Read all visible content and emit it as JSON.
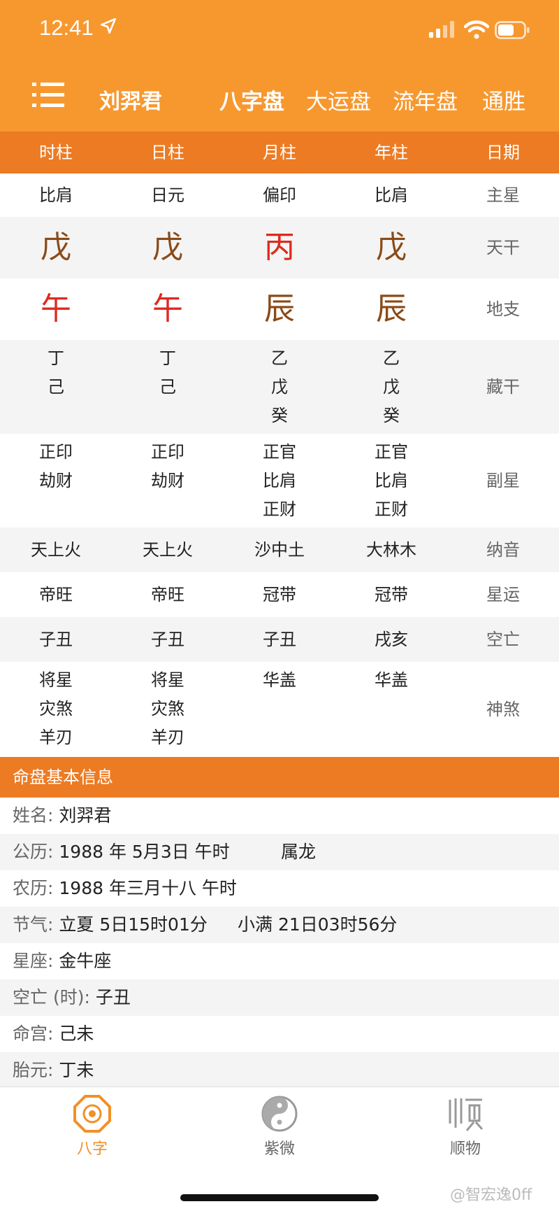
{
  "status": {
    "time": "12:41"
  },
  "header": {
    "name": "刘羿君",
    "tabs": [
      "八字盘",
      "大运盘",
      "流年盘",
      "通胜"
    ]
  },
  "columns": [
    "时柱",
    "日柱",
    "月柱",
    "年柱",
    "日期"
  ],
  "rows": {
    "main_star": {
      "label": "主星",
      "values": [
        "比肩",
        "日元",
        "偏印",
        "比肩"
      ]
    },
    "stem": {
      "label": "天干",
      "values": [
        "戊",
        "戊",
        "丙",
        "戊"
      ]
    },
    "branch": {
      "label": "地支",
      "values": [
        "午",
        "午",
        "辰",
        "辰"
      ]
    },
    "hidden": {
      "label": "藏干",
      "values": [
        [
          "丁",
          "己"
        ],
        [
          "丁",
          "己"
        ],
        [
          "乙",
          "戊",
          "癸"
        ],
        [
          "乙",
          "戊",
          "癸"
        ]
      ]
    },
    "sub_star": {
      "label": "副星",
      "values": [
        [
          "正印",
          "劫财"
        ],
        [
          "正印",
          "劫财"
        ],
        [
          "正官",
          "比肩",
          "正财"
        ],
        [
          "正官",
          "比肩",
          "正财"
        ]
      ]
    },
    "nayin": {
      "label": "纳音",
      "values": [
        "天上火",
        "天上火",
        "沙中土",
        "大林木"
      ]
    },
    "xingyun": {
      "label": "星运",
      "values": [
        "帝旺",
        "帝旺",
        "冠带",
        "冠带"
      ]
    },
    "kongwang": {
      "label": "空亡",
      "values": [
        "子丑",
        "子丑",
        "子丑",
        "戌亥"
      ]
    },
    "shensha": {
      "label": "神煞",
      "values": [
        [
          "将星",
          "灾煞",
          "羊刃"
        ],
        [
          "将星",
          "灾煞",
          "羊刃"
        ],
        [
          "华盖"
        ],
        [
          "华盖"
        ]
      ]
    }
  },
  "info": {
    "title": "命盘基本信息",
    "name_label": "姓名:",
    "name_value": "刘羿君",
    "solar_label": "公历:",
    "solar_value": "1988 年 5月3日 午时",
    "zodiac": "属龙",
    "lunar_label": "农历:",
    "lunar_value": "1988 年三月十八 午时",
    "jieqi_label": "节气:",
    "jieqi_value1": "立夏 5日15时01分",
    "jieqi_value2": "小满 21日03时56分",
    "star_label": "星座:",
    "star_value": "金牛座",
    "kong_label": "空亡 (时):",
    "kong_value": "子丑",
    "minggong_label": "命宫:",
    "minggong_value": "己未",
    "taiyuan_label": "胎元:",
    "taiyuan_value": "丁未"
  },
  "tabbar": {
    "bazi": "八字",
    "ziwei": "紫微",
    "shunwu": "顺物"
  },
  "watermark": "@智宏逸0ff",
  "colors": {
    "orange": "#f7982f",
    "deep_orange": "#ec7b23",
    "brown": "#8a4a17",
    "red": "#de2a1f"
  }
}
